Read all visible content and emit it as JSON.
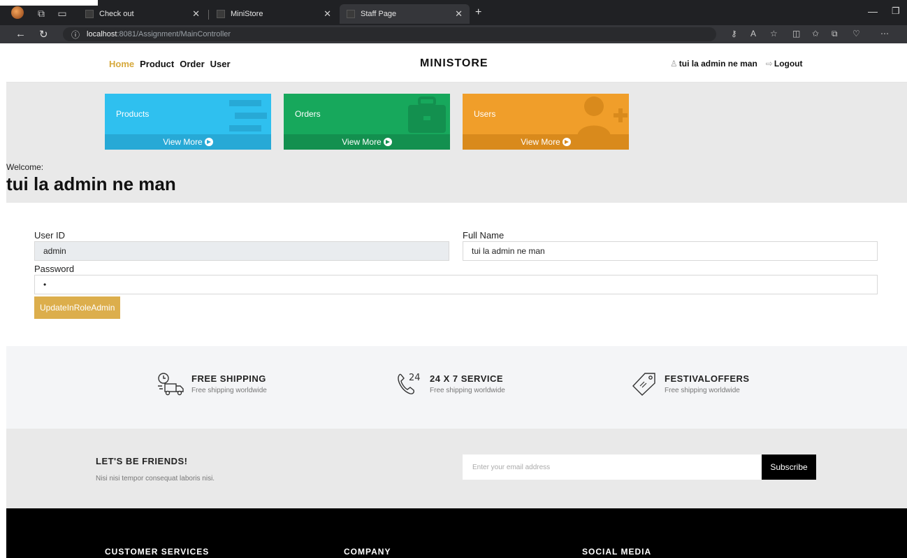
{
  "browser": {
    "tabs": [
      {
        "title": "Check out",
        "active": false
      },
      {
        "title": "MiniStore",
        "active": false
      },
      {
        "title": "Staff Page",
        "active": true
      }
    ],
    "url_host": "localhost",
    "url_path": ":8081/Assignment/MainController"
  },
  "header": {
    "nav": [
      "Home",
      "Product",
      "Order",
      "User"
    ],
    "brand": "MINISTORE",
    "username": "tui la admin ne man",
    "logout": "Logout"
  },
  "cards": [
    {
      "label": "Products",
      "footer": "View More",
      "color": "#2fc0ef"
    },
    {
      "label": "Orders",
      "footer": "View More",
      "color": "#17a85c"
    },
    {
      "label": "Users",
      "footer": "View More",
      "color": "#f09e2a"
    }
  ],
  "welcome": {
    "label": "Welcome:",
    "name": "tui la admin ne man"
  },
  "form": {
    "user_id_label": "User ID",
    "user_id_value": "admin",
    "full_name_label": "Full Name",
    "full_name_value": "tui la admin ne man",
    "password_label": "Password",
    "password_value": "1",
    "submit_label": "UpdateInRoleAdmin"
  },
  "features": [
    {
      "title": "FREE SHIPPING",
      "sub": "Free shipping worldwide",
      "icon": "delivery-truck-icon"
    },
    {
      "title": "24 X 7 SERVICE",
      "sub": "Free shipping worldwide",
      "icon": "phone-24-icon"
    },
    {
      "title": "FESTIVALOFFERS",
      "sub": "Free shipping worldwide",
      "icon": "price-tag-icon"
    }
  ],
  "newsletter": {
    "title": "LET'S BE FRIENDS!",
    "sub": "Nisi nisi tempor consequat laboris nisi.",
    "placeholder": "Enter your email address",
    "button": "Subscribe"
  },
  "footer": {
    "headings": [
      "CUSTOMER SERVICES",
      "COMPANY",
      "SOCIAL MEDIA"
    ]
  },
  "colors": {
    "accent": "#d6a93c",
    "button_gold": "#dcae4c"
  }
}
